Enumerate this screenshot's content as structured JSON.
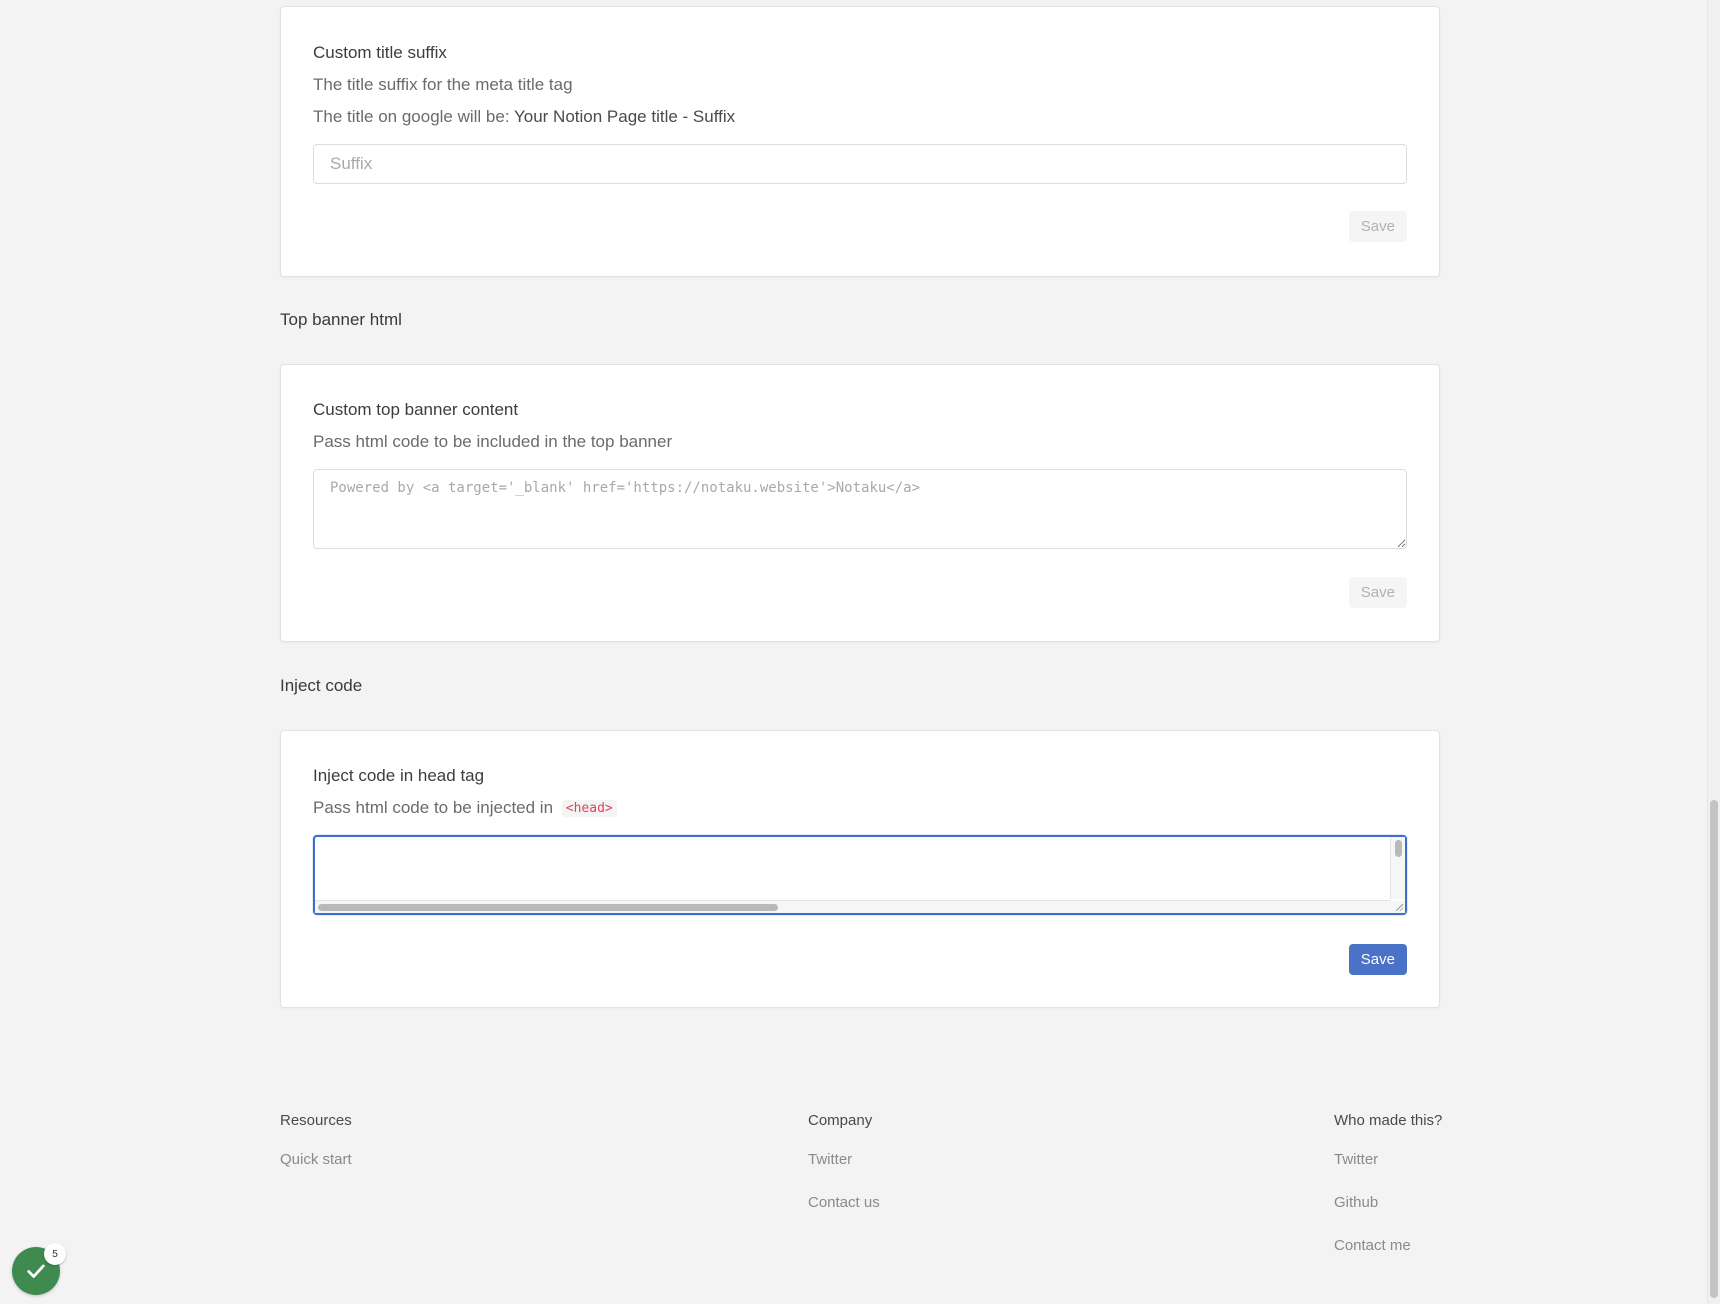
{
  "suffix_card": {
    "title": "Custom title suffix",
    "description": "The title suffix for the meta title tag",
    "google_prefix": "The title on google will be:",
    "google_example": "Your Notion Page title - Suffix",
    "input_placeholder": "Suffix",
    "input_value": "",
    "save_label": "Save"
  },
  "banner_section": {
    "heading": "Top banner html"
  },
  "banner_card": {
    "title": "Custom top banner content",
    "description": "Pass html code to be included in the top banner",
    "textarea_placeholder": "Powered by <a target='_blank' href='https://notaku.website'>Notaku</a>",
    "save_label": "Save"
  },
  "inject_section": {
    "heading": "Inject code"
  },
  "inject_card": {
    "title": "Inject code in head tag",
    "description": "Pass html code to be injected in",
    "code_tag": "<head>",
    "textarea_value": "",
    "save_label": "Save"
  },
  "footer": {
    "columns": [
      {
        "heading": "Resources",
        "links": [
          "Quick start"
        ]
      },
      {
        "heading": "Company",
        "links": [
          "Twitter",
          "Contact us"
        ]
      },
      {
        "heading": "Who made this?",
        "links": [
          "Twitter",
          "Github",
          "Contact me"
        ]
      }
    ]
  },
  "status_widget": {
    "icon": "checkmark-icon",
    "badge_count": "5"
  },
  "colors": {
    "page_background": "#f3f3f3",
    "card_background": "#ffffff",
    "primary_button": "#4a72c6",
    "focus_border": "#3b6fc9",
    "code_tag_text": "#e0455b",
    "status_widget": "#3f8a4f"
  }
}
